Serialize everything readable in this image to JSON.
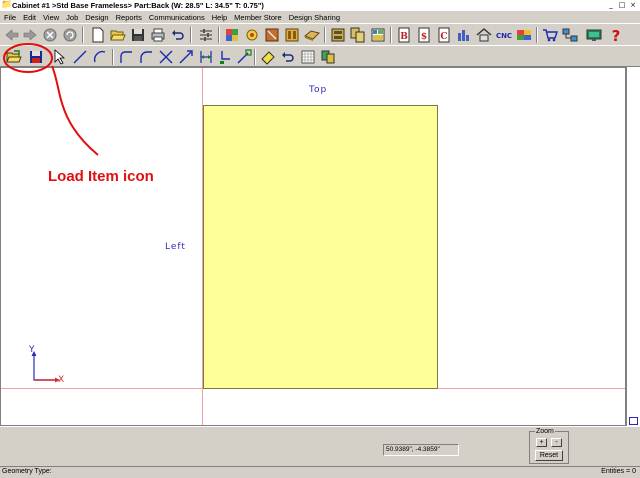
{
  "window": {
    "title": "Cabinet #1 >Std Base Frameless> Part:Back (W: 28.5\" L: 34.5\" T: 0.75\")",
    "app_icon": "cabinet-app-icon"
  },
  "menu": [
    "File",
    "Edit",
    "View",
    "Job",
    "Design",
    "Reports",
    "Communications",
    "Help",
    "Member Store",
    "Design Sharing"
  ],
  "toolbar1": {
    "icons": [
      "back-arrow-icon",
      "forward-arrow-icon",
      "stop-icon",
      "refresh-icon",
      "new-document-icon",
      "open-folder-icon",
      "save-icon",
      "print-icon",
      "undo-icon",
      "settings-sliders-icon",
      "materials-icon",
      "hardware-icon",
      "door-style-icon",
      "drawer-icon",
      "edgeband-icon",
      "cabinet-library-icon",
      "cabinet-list-icon",
      "cutlist-icon",
      "bid-report-icon",
      "cost-report-icon",
      "cut-report-icon",
      "optimize-icon",
      "assembly-icon",
      "cnc-icon",
      "layout-icon",
      "shopping-cart-icon",
      "network-icon",
      "monitor-icon",
      "help-icon"
    ],
    "cnc_label": "CNC",
    "report_letters": {
      "b": "B",
      "s": "$",
      "c": "C"
    }
  },
  "toolbar2": {
    "icons": [
      "load-item-icon",
      "save-item-icon",
      "select-arrow-icon",
      "line-icon",
      "arc-icon",
      "fillet-icon",
      "round-corner-icon",
      "trim-icon",
      "extend-arrow-icon",
      "dimension-icon",
      "move-node-icon",
      "move-icon",
      "eraser-icon",
      "undo-icon",
      "grid-icon",
      "layer-icon"
    ]
  },
  "canvas": {
    "label_top": "Top",
    "label_left": "Left",
    "axis_x": "X",
    "axis_y": "Y"
  },
  "annotation": {
    "text": "Load Item icon",
    "color": "#e01010"
  },
  "bottom": {
    "coordinates": "50.9389\", -4.3859\"",
    "zoom_label": "Zoom",
    "zoom_in": "+",
    "zoom_out": "-",
    "reset_label": "Reset"
  },
  "status": {
    "left": "Geometry Type:",
    "right": "Entities = 0"
  },
  "colors": {
    "part_fill": "#ffff99",
    "guide_line": "#f0a0a0",
    "label_blue": "#2b2bb8",
    "background": "#d4d0c8"
  }
}
